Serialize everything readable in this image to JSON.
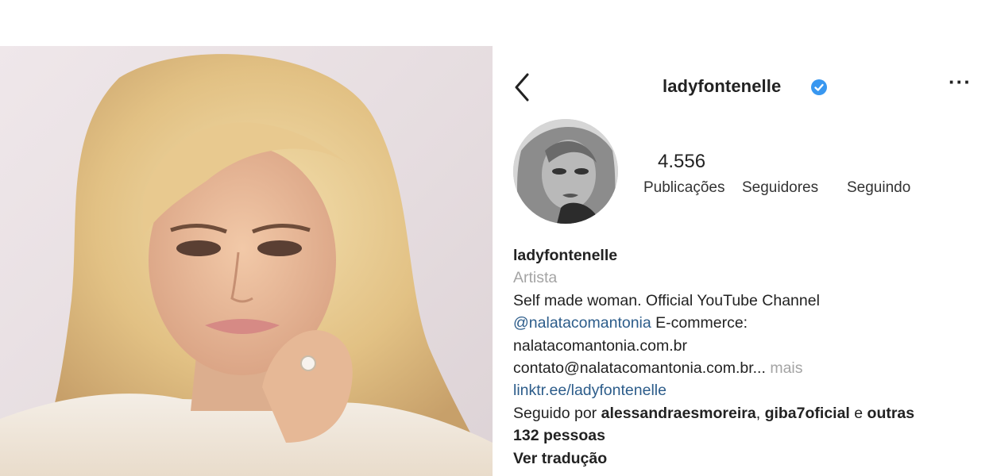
{
  "header": {
    "username": "ladyfontenelle",
    "back_icon": "chevron-left-icon",
    "verified_icon": "verified-badge-icon",
    "more_icon": "more-dots-icon",
    "more_label": "···"
  },
  "stats": {
    "posts_value": "4.556",
    "posts_label": "Publicações",
    "followers_label": "Seguidores",
    "following_label": "Seguindo"
  },
  "bio": {
    "name": "ladyfontenelle",
    "category": "Artista",
    "line1": "Self made woman. Official YouTube Channel",
    "mention": "@nalatacomantonia",
    "line2_rest": " E-commerce:",
    "line3": "nalatacomantonia.com.br",
    "line4": "contato@nalatacomantonia.com.br...",
    "more_label": " mais",
    "link": "linktr.ee/ladyfontenelle",
    "followed_prefix": "Seguido por ",
    "followed_user1": "alessandraesmoreira",
    "followed_sep": ", ",
    "followed_user2": "giba7oficial",
    "followed_and": " e ",
    "followed_others": "outras",
    "followed_count": "132 pessoas",
    "translate_label": "Ver tradução"
  },
  "colors": {
    "link": "#2c5c8a",
    "verified": "#3897f0",
    "muted": "#a4a4a4"
  }
}
